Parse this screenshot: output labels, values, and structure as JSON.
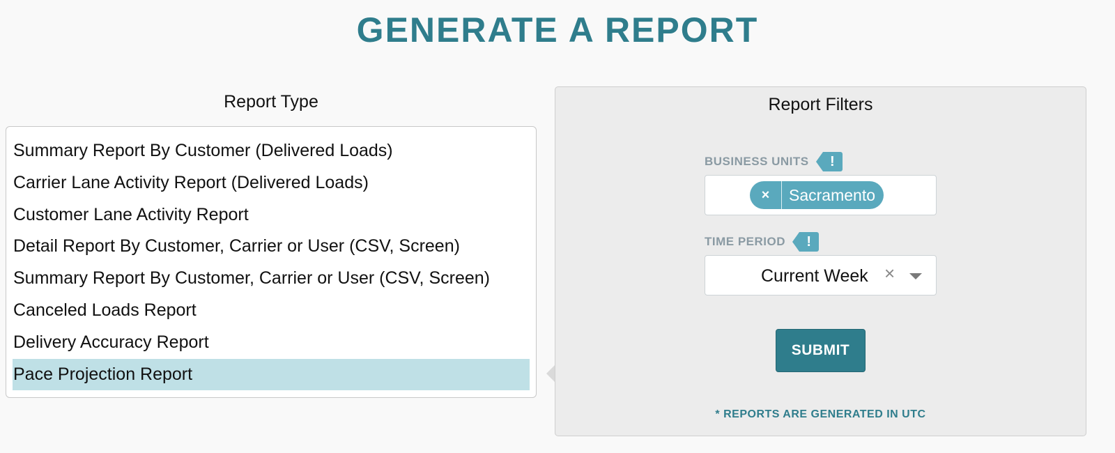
{
  "page": {
    "title": "GENERATE A REPORT"
  },
  "report_type": {
    "heading": "Report Type",
    "selected_index": 7,
    "items": [
      "Summary Report By Customer (Delivered Loads)",
      "Carrier Lane Activity Report (Delivered Loads)",
      "Customer Lane Activity Report",
      "Detail Report By Customer, Carrier or User (CSV, Screen)",
      "Summary Report By Customer, Carrier or User (CSV, Screen)",
      "Canceled Loads Report",
      "Delivery Accuracy Report",
      "Pace Projection Report"
    ]
  },
  "filters": {
    "heading": "Report Filters",
    "business_units": {
      "label": "BUSINESS UNITS",
      "alert_icon": "!",
      "chip_remove": "×",
      "selected": "Sacramento"
    },
    "time_period": {
      "label": "TIME PERIOD",
      "alert_icon": "!",
      "value": "Current Week",
      "clear_icon": "×"
    },
    "submit_label": "SUBMIT",
    "note": "* REPORTS ARE GENERATED IN UTC"
  },
  "colors": {
    "accent": "#2f7d8c",
    "chip": "#5aa9bd",
    "selected_row": "#bfe0e6"
  }
}
